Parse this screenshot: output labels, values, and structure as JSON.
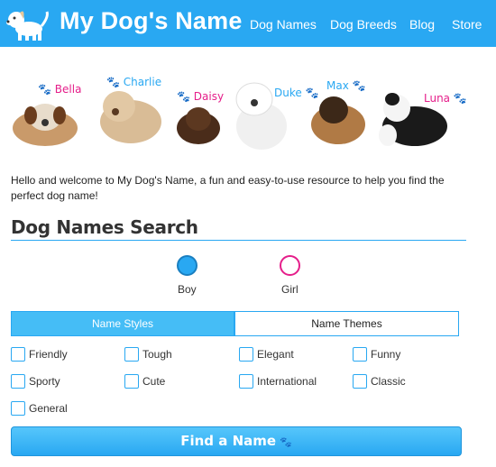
{
  "header": {
    "brand": "My Dog's Name",
    "nav": [
      "Dog Names",
      "Dog Breeds",
      "Blog",
      "Store"
    ],
    "bar_color": "#29a8f2"
  },
  "banner": {
    "puppies": [
      {
        "name": "Bella",
        "color": "#e51e8a"
      },
      {
        "name": "Charlie",
        "color": "#29a8f2"
      },
      {
        "name": "Daisy",
        "color": "#e51e8a"
      },
      {
        "name": "Duke",
        "color": "#29a8f2"
      },
      {
        "name": "Max",
        "color": "#29a8f2"
      },
      {
        "name": "Luna",
        "color": "#e51e8a"
      }
    ]
  },
  "intro": "Hello and welcome to My Dog's Name, a fun and easy-to-use resource to help you find the perfect dog name!",
  "search": {
    "title": "Dog Names Search",
    "gender": {
      "options": [
        "Boy",
        "Girl"
      ],
      "selected": "Boy"
    },
    "tabs": [
      "Name Styles",
      "Name Themes"
    ],
    "active_tab": "Name Styles",
    "checkboxes": [
      "Friendly",
      "Tough",
      "Elegant",
      "Funny",
      "Sporty",
      "Cute",
      "International",
      "Classic",
      "General"
    ],
    "button_label": "Find a Name"
  }
}
